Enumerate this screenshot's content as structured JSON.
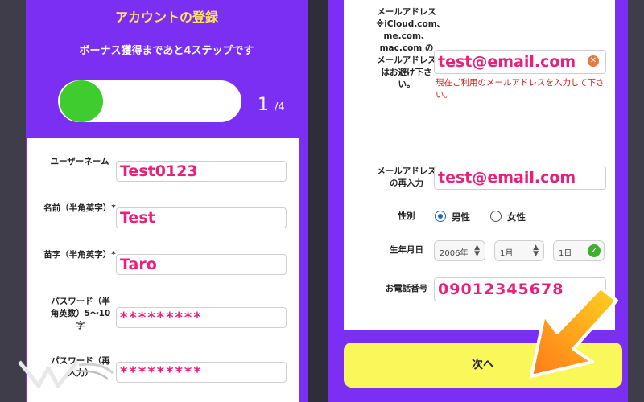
{
  "left": {
    "title": "アカウントの登録",
    "subtitle": "ボーナス獲得まであと4ステップです",
    "step_current": "1",
    "step_total": "/4",
    "progress_fraction": 0.25,
    "fields": [
      {
        "label": "ユーザーネーム",
        "value": "Test0123"
      },
      {
        "label": "名前（半角英字）*",
        "value": "Test"
      },
      {
        "label": "苗字（半角英字）*",
        "value": "Taro"
      },
      {
        "label": "パスワード（半角英数）5～10字",
        "value": "*********"
      },
      {
        "label": "パスワード（再入力）",
        "value": "*********"
      }
    ]
  },
  "right": {
    "email_label": "メールアドレス ※iCloud.com、me.com、mac.com のメールアドレスはお避け下さい。",
    "email_value": "test@email.com",
    "email_error": "現在ご利用のメールアドレスを入力して下さい。",
    "email_confirm_label": "メールアドレスの再入力",
    "email_confirm_value": "test@email.com",
    "gender_label": "性別",
    "gender_options": [
      "男性",
      "女性"
    ],
    "gender_selected": "男性",
    "birthdate_label": "生年月日",
    "birth_year": "2006年",
    "birth_month": "1月",
    "birth_day": "1日",
    "phone_label": "お電話番号",
    "phone_value": "09012345678",
    "next_label": "次へ"
  },
  "icons": {
    "clear": "clear-icon",
    "valid": "check-icon",
    "pointer": "arrow-icon"
  },
  "colors": {
    "panel": "#7b2ff2",
    "accent_text": "#ffe45c",
    "progress": "#3fcc2e",
    "value_text": "#e8207a",
    "button": "#f9f75a",
    "arrow": "#ff8a1f"
  },
  "logo": {
    "text": "WISDOM"
  }
}
